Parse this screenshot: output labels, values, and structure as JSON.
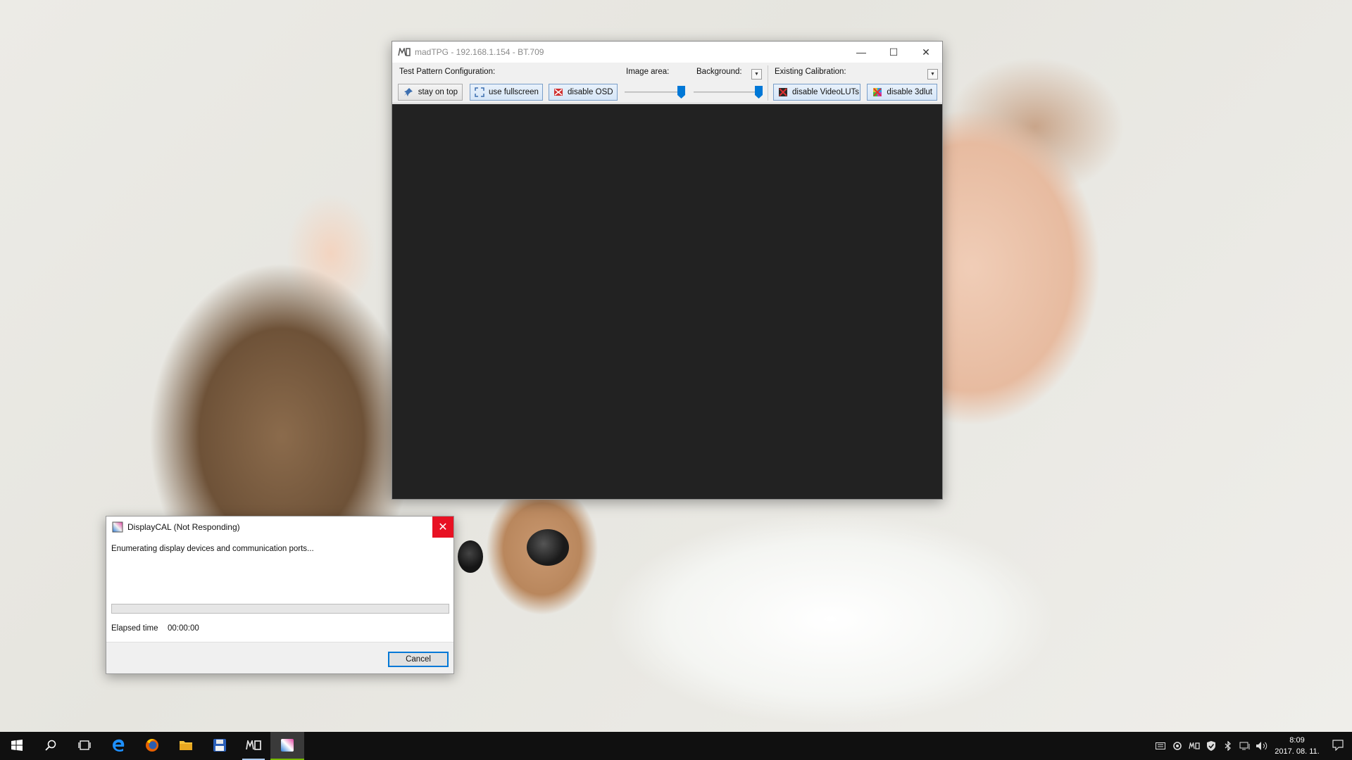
{
  "colors": {
    "accent": "#0078d7",
    "close_red": "#e81123",
    "canvas": "#222222",
    "progress_green": "#06b025"
  },
  "madtpg": {
    "title": "madTPG  -  192.168.1.154  -  BT.709",
    "labels": {
      "config": "Test Pattern Configuration:",
      "image_area": "Image area:",
      "background": "Background:",
      "calibration": "Existing Calibration:"
    },
    "buttons": {
      "stay_on_top": "stay on top",
      "use_fullscreen": "use fullscreen",
      "disable_osd": "disable OSD",
      "disable_videoluts": "disable VideoLUTs",
      "disable_3dlut": "disable 3dlut"
    },
    "sliders": {
      "image_area_level": 1.0,
      "background_level": 1.0
    },
    "controls": {
      "minimize": "—",
      "maximize": "☐",
      "close": "✕"
    }
  },
  "displaycal": {
    "title": "DisplayCAL (Not Responding)",
    "message": "Enumerating display devices and communication ports...",
    "progress": 0,
    "elapsed_label": "Elapsed time",
    "elapsed_value": "00:00:00",
    "cancel_label": "Cancel",
    "close": "✕"
  },
  "taskbar": {
    "items": [
      "windows-start-icon",
      "search-icon",
      "task-view-icon",
      "edge-icon",
      "firefox-icon",
      "file-explorer-icon",
      "floppy-app-icon",
      "madtpg-icon",
      "displaycal-icon"
    ],
    "clock_time": "8:09",
    "clock_date": "2017. 08. 11."
  }
}
